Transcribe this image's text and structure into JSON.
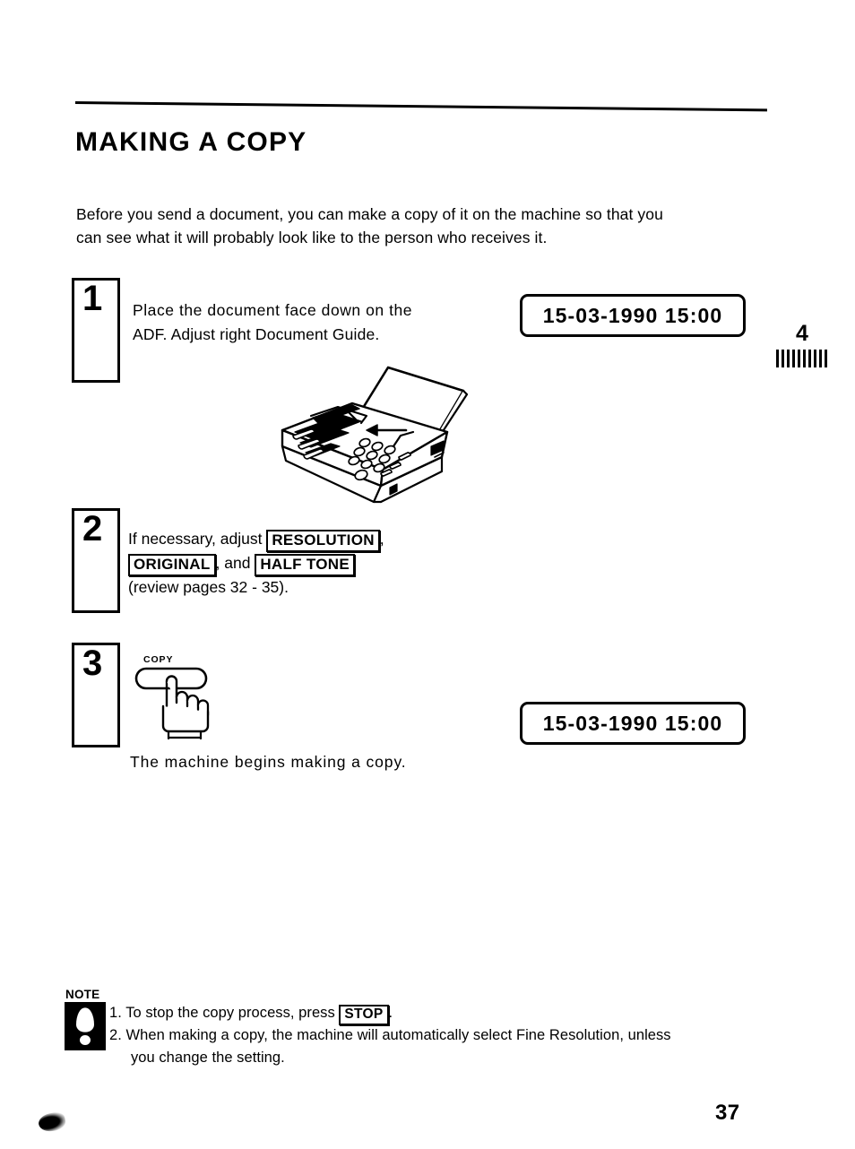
{
  "page": {
    "title": "MAKING A COPY",
    "number": "37",
    "chapter_tab": {
      "number": "4",
      "marker": "barcode-bars"
    }
  },
  "intro": {
    "line1": "Before you send a document, you can make a copy of it on the machine so that you",
    "line2": "can see what it will probably look like to the person who receives it."
  },
  "steps": [
    {
      "number": "1",
      "line1": "Place the document face down on the",
      "line2": "ADF. Adjust right Document Guide.",
      "illustration": "fax-machine-with-document-in-adf"
    },
    {
      "number": "2",
      "line1_pre": "If necessary, adjust",
      "key1": "RESOLUTION",
      "line1_post": ",",
      "key2": "ORIGINAL",
      "line2_mid": ", and",
      "key3": "HALF TONE",
      "line3": "(review pages 32 - 35)."
    },
    {
      "number": "3",
      "button_label": "COPY",
      "illustration": "hand-pressing-copy-button",
      "caption": "The machine begins making a copy."
    }
  ],
  "displays": [
    {
      "text": "15-03-1990  15:00"
    },
    {
      "text": "15-03-1990  15:00"
    }
  ],
  "note": {
    "heading": "NOTE",
    "icon": "exclamation-mark-icon",
    "items": [
      {
        "pre": "1. To stop the copy process, press",
        "key": "STOP",
        "post": "."
      },
      {
        "line1": "2. When making a copy, the machine will automatically select Fine Resolution, unless",
        "line2": "you change the setting."
      }
    ]
  },
  "colors": {
    "ink": "#000000",
    "paper": "#ffffff"
  }
}
